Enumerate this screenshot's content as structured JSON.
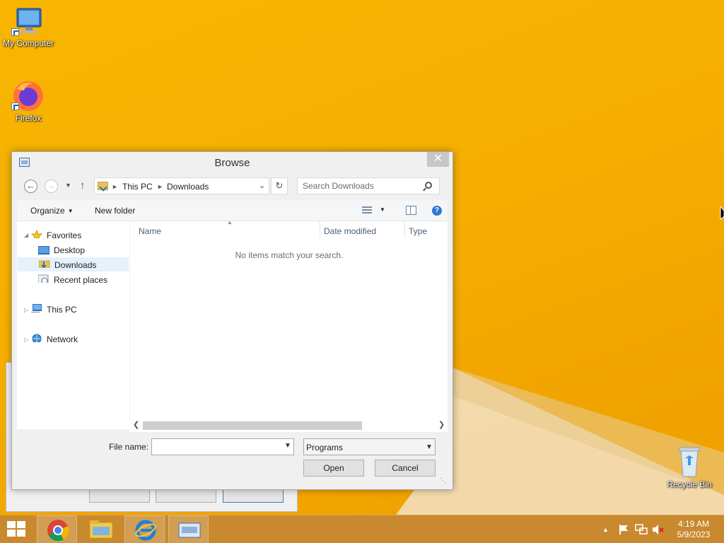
{
  "desktop": {
    "icons": [
      {
        "label": "My Computer"
      },
      {
        "label": "Firefox"
      },
      {
        "label": "Recycle Bin"
      }
    ]
  },
  "dialog": {
    "title": "Browse",
    "close_glyph": "✕",
    "address": {
      "segments": [
        "This PC",
        "Downloads"
      ]
    },
    "search": {
      "placeholder": "Search Downloads"
    },
    "toolbar": {
      "organize": "Organize",
      "new_folder": "New folder"
    },
    "nav": {
      "favorites": "Favorites",
      "desktop": "Desktop",
      "downloads": "Downloads",
      "recent": "Recent places",
      "this_pc": "This PC",
      "network": "Network"
    },
    "columns": {
      "name": "Name",
      "date_modified": "Date modified",
      "type": "Type"
    },
    "empty_message": "No items match your search.",
    "file_name_label": "File name:",
    "file_name_value": "",
    "file_type": "Programs",
    "open_label": "Open",
    "cancel_label": "Cancel"
  },
  "taskbar": {
    "clock_time": "4:19 AM",
    "clock_date": "5/9/2023"
  },
  "colors": {
    "wallpaper": "#f5b400",
    "taskbar": "#c9892e",
    "selection": "#e5f1fb",
    "help_icon": "#2f77d1"
  }
}
